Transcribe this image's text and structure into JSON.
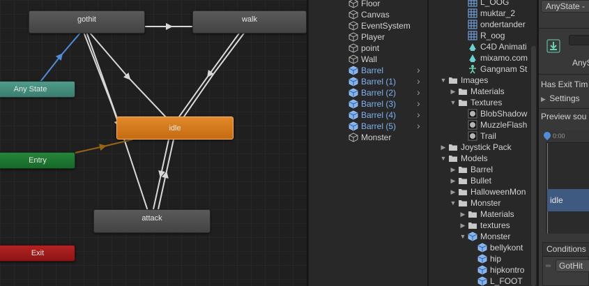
{
  "graph": {
    "states": {
      "gothit": "gothit",
      "walk": "walk",
      "idle": "idle",
      "attack": "attack",
      "any_state": "Any State",
      "entry": "Entry",
      "exit": "Exit"
    }
  },
  "hierarchy": {
    "items": [
      {
        "label": "Floor",
        "style": "normal",
        "expandable": false
      },
      {
        "label": "Canvas",
        "style": "normal",
        "expandable": false
      },
      {
        "label": "EventSystem",
        "style": "normal",
        "expandable": false
      },
      {
        "label": "Player",
        "style": "normal",
        "expandable": false
      },
      {
        "label": "point",
        "style": "normal",
        "expandable": false
      },
      {
        "label": "Wall",
        "style": "normal",
        "expandable": false
      },
      {
        "label": "Barrel",
        "style": "prefab",
        "expandable": true
      },
      {
        "label": "Barrel (1)",
        "style": "prefab",
        "expandable": true
      },
      {
        "label": "Barrel (2)",
        "style": "prefab",
        "expandable": true
      },
      {
        "label": "Barrel (3)",
        "style": "prefab",
        "expandable": true
      },
      {
        "label": "Barrel (4)",
        "style": "prefab",
        "expandable": true
      },
      {
        "label": "Barrel (5)",
        "style": "prefab",
        "expandable": true
      },
      {
        "label": "Monster",
        "style": "normal",
        "expandable": false
      }
    ]
  },
  "project": {
    "items": [
      {
        "label": "L_OOG",
        "icon": "grid-icon",
        "indent": 3,
        "arrow": ""
      },
      {
        "label": "muktar_2",
        "icon": "grid-icon",
        "indent": 3,
        "arrow": ""
      },
      {
        "label": "ondertander",
        "icon": "grid-icon",
        "indent": 3,
        "arrow": ""
      },
      {
        "label": "R_oog",
        "icon": "grid-icon",
        "indent": 3,
        "arrow": ""
      },
      {
        "label": "C4D Animati",
        "icon": "animation-icon",
        "indent": 3,
        "arrow": ""
      },
      {
        "label": "mixamo.com",
        "icon": "animation-icon",
        "indent": 3,
        "arrow": ""
      },
      {
        "label": "Gangnam St",
        "icon": "avatar-icon",
        "indent": 3,
        "arrow": ""
      },
      {
        "label": "Images",
        "icon": "folder-icon",
        "indent": 1,
        "arrow": "down"
      },
      {
        "label": "Materials",
        "icon": "folder-icon",
        "indent": 2,
        "arrow": "right"
      },
      {
        "label": "Textures",
        "icon": "folder-icon",
        "indent": 2,
        "arrow": "down"
      },
      {
        "label": "BlobShadow",
        "icon": "texture-icon",
        "indent": 3,
        "arrow": ""
      },
      {
        "label": "MuzzleFlash",
        "icon": "texture-icon",
        "indent": 3,
        "arrow": ""
      },
      {
        "label": "Trail",
        "icon": "texture-icon",
        "indent": 3,
        "arrow": ""
      },
      {
        "label": "Joystick Pack",
        "icon": "folder-icon",
        "indent": 1,
        "arrow": "right"
      },
      {
        "label": "Models",
        "icon": "folder-icon",
        "indent": 1,
        "arrow": "down"
      },
      {
        "label": "Barrel",
        "icon": "folder-icon",
        "indent": 2,
        "arrow": "right"
      },
      {
        "label": "Bullet",
        "icon": "folder-icon",
        "indent": 2,
        "arrow": "right"
      },
      {
        "label": "HalloweenMon",
        "icon": "folder-icon",
        "indent": 2,
        "arrow": "right"
      },
      {
        "label": "Monster",
        "icon": "folder-icon",
        "indent": 2,
        "arrow": "down"
      },
      {
        "label": "Materials",
        "icon": "folder-icon",
        "indent": 3,
        "arrow": "right"
      },
      {
        "label": "textures",
        "icon": "folder-icon",
        "indent": 3,
        "arrow": "right"
      },
      {
        "label": "Monster",
        "icon": "prefab-icon",
        "indent": 3,
        "arrow": "down"
      },
      {
        "label": "bellykont",
        "icon": "prefab-icon",
        "indent": 4,
        "arrow": ""
      },
      {
        "label": "hip",
        "icon": "prefab-icon",
        "indent": 4,
        "arrow": ""
      },
      {
        "label": "hipkontro",
        "icon": "prefab-icon",
        "indent": 4,
        "arrow": ""
      },
      {
        "label": "L_FOOT",
        "icon": "prefab-icon",
        "indent": 4,
        "arrow": ""
      }
    ]
  },
  "inspector": {
    "transition_title": "AnyState -",
    "subtitle": "AnyS",
    "has_exit_time": "Has Exit Tim",
    "settings": "Settings",
    "preview_source": "Preview sou",
    "timeline_start": "0:00",
    "clip_label": "idle",
    "conditions_header": "Conditions",
    "condition_param": "GotHit"
  },
  "colors": {
    "state_default": "#4b4b4b",
    "state_default_highlight": "#e0832a",
    "any_state": "#3f8a78",
    "entry": "#1d7a31",
    "exit": "#a01c1c",
    "transition_white": "#d8d8d8",
    "transition_selected": "#4f8ed6",
    "transition_entry": "#9a6417",
    "prefab_text": "#7fb1f4"
  }
}
